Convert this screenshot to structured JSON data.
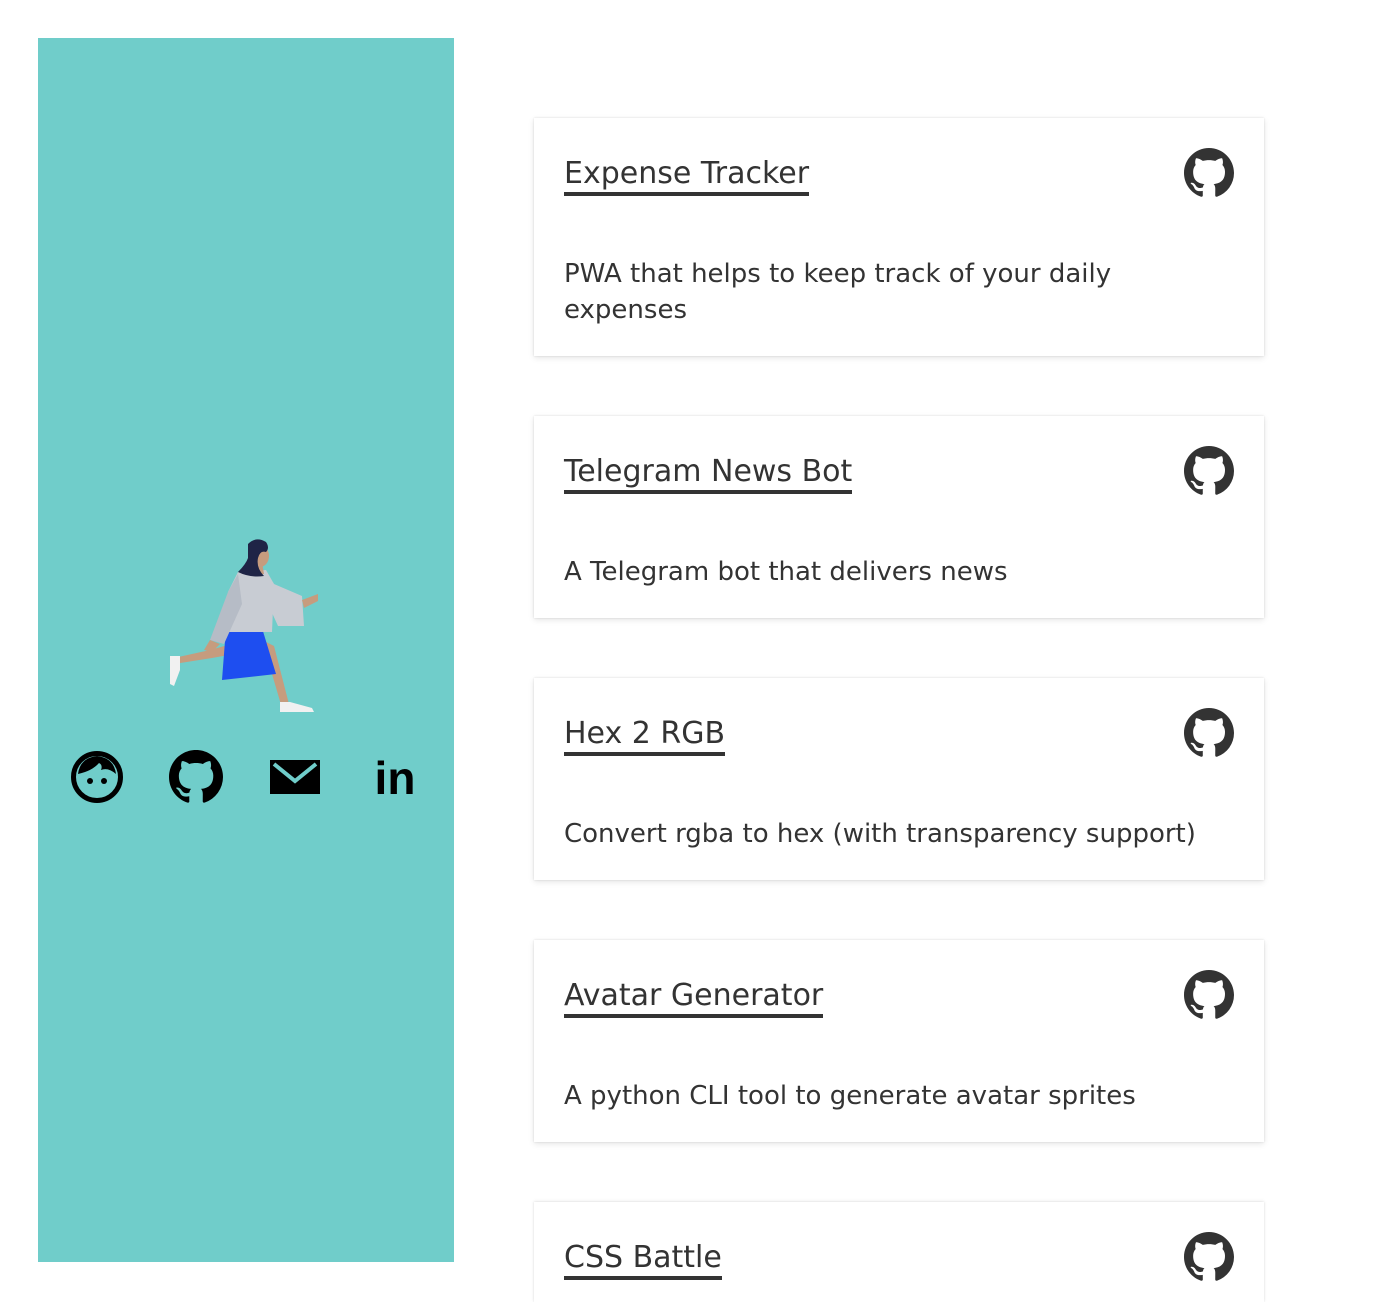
{
  "sidebar": {
    "background": "#70cdca",
    "illustration": "woman-walking-illustration",
    "social_links": [
      {
        "icon": "face-icon",
        "label": "About"
      },
      {
        "icon": "github-icon",
        "label": "GitHub"
      },
      {
        "icon": "mail-icon",
        "label": "Email"
      },
      {
        "icon": "linkedin-icon",
        "label": "LinkedIn",
        "text": "in"
      }
    ]
  },
  "projects": [
    {
      "title": "Expense Tracker",
      "description": "PWA that helps to keep track of your daily expenses",
      "icon": "github-icon"
    },
    {
      "title": "Telegram News Bot",
      "description": "A Telegram bot that delivers news",
      "icon": "github-icon"
    },
    {
      "title": "Hex 2 RGB",
      "description": "Convert rgba to hex (with transparency support)",
      "icon": "github-icon"
    },
    {
      "title": "Avatar Generator",
      "description": "A python CLI tool to generate avatar sprites",
      "icon": "github-icon"
    },
    {
      "title": "CSS Battle",
      "description": "",
      "icon": "github-icon"
    }
  ],
  "colors": {
    "accent": "#70cdca",
    "text": "#333333",
    "skirt": "#1e4ef0"
  }
}
